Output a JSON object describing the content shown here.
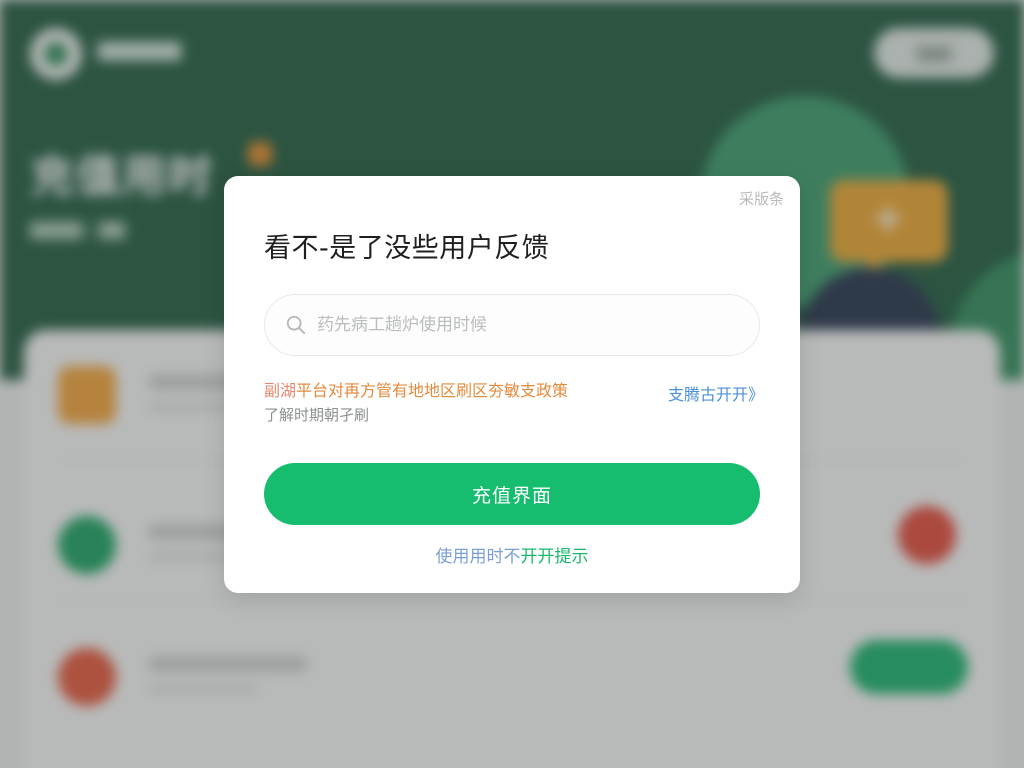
{
  "colors": {
    "header_bg": "#1f5a3e",
    "primary_green": "#17bd6f",
    "link_blue": "#4a90d8",
    "notice_orange": "#e58a3c"
  },
  "background": {
    "page_title": "充值用时",
    "icons": [
      "app-logo-icon",
      "gift-icon",
      "check-icon",
      "plus-icon",
      "chat-bubble-plus-icon",
      "red-badge-icon"
    ]
  },
  "dialog": {
    "close_label": "采版条",
    "title": "看不-是了没些用户反馈",
    "search": {
      "placeholder": "药先病工趟炉使用时候",
      "value": ""
    },
    "notice": {
      "prefix": "副湖",
      "text": "平台对再方管有地地区刷区夯敏支政策",
      "line2": "了解时期朝孑刷"
    },
    "notice_link": "支腾古开开》",
    "primary_button": "充值界面",
    "secondary_link_part1": "使用用时不",
    "secondary_link_part2": "开开提示"
  }
}
